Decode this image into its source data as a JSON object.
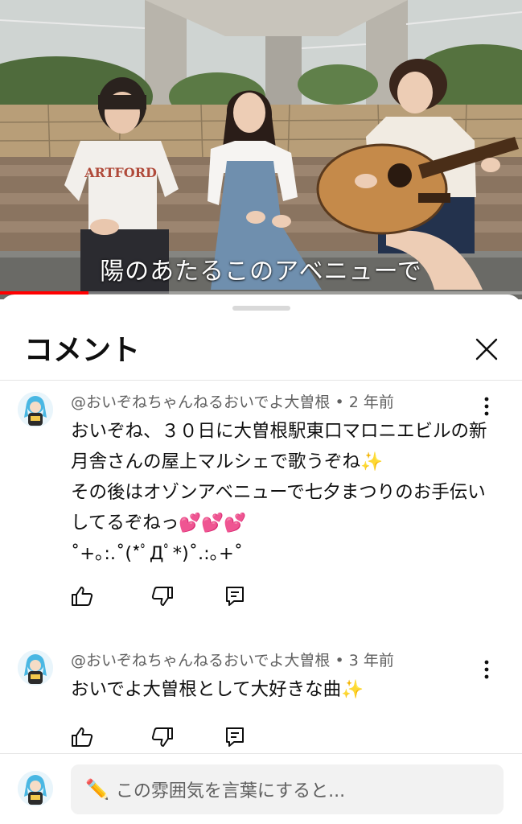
{
  "video": {
    "subtitle": "陽のあたるこのアベニューで",
    "progress_fraction": 0.17,
    "progress_color": "#ff0000"
  },
  "sheet": {
    "title": "コメント",
    "close_icon": "close-icon"
  },
  "comments": [
    {
      "author": "@おいぞねちゃんねるおいでよ大曽根",
      "time": "2 年前",
      "text": "おいぞね、３０日に大曽根駅東口マロニエビルの新月舎さんの屋上マルシェで歌うぞね✨\nその後はオゾンアベニューで七夕まつりのお手伝いしてるぞねっ💕💕💕\n˚+｡:.˚(*ﾟДﾟ*)˚.:｡+˚",
      "icons": [
        "like-icon",
        "dislike-icon",
        "reply-icon",
        "more-vert-icon"
      ]
    },
    {
      "author": "@おいぞねちゃんねるおいでよ大曽根",
      "time": "3 年前",
      "text": "おいでよ大曽根として大好きな曲✨",
      "icons": [
        "like-icon",
        "dislike-icon",
        "reply-icon",
        "more-vert-icon"
      ]
    }
  ],
  "input": {
    "emoji": "✏️",
    "placeholder": "この雰囲気を言葉にすると..."
  }
}
